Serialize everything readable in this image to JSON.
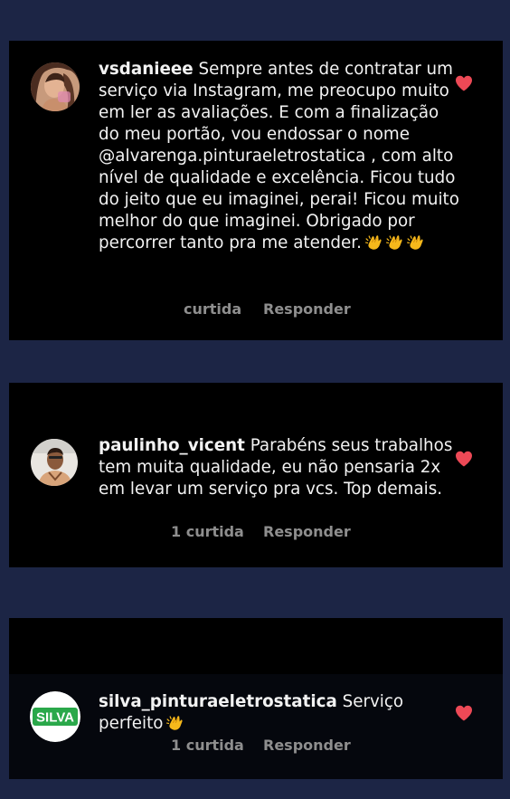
{
  "comments": [
    {
      "username": "vsdanieee",
      "text": "Sempre antes de contratar um serviço via Instagram, me preocupo muito em ler as avaliações.  E com a finalização do meu portão,  vou endossar o nome @alvarenga.pinturaeletrostatica , com alto nível de qualidade e excelência. Ficou tudo do jeito que eu imaginei, perai! Ficou muito melhor do que imaginei.  Obrigado por percorrer tanto pra me atender.",
      "emoji": "clapping-hands-icon x3",
      "likes": "curtida",
      "reply": "Responder",
      "liked": true,
      "avatar": "profile-photo"
    },
    {
      "username": "paulinho_vicent",
      "text": "Parabéns seus trabalhos tem muita qualidade, eu não pensaria 2x em levar um serviço pra vcs. Top demais.",
      "likes": "1 curtida",
      "reply": "Responder",
      "liked": true,
      "avatar": "profile-photo"
    },
    {
      "username": "silva_pinturaeletrostatica",
      "text": "Serviço perfeito",
      "emoji": "clapping-hands-icon",
      "likes": "1 curtida",
      "reply": "Responder",
      "liked": true,
      "avatar_logo_text": "SILVA"
    }
  ],
  "colors": {
    "background": "#1c2545",
    "card": "#000000",
    "text": "#f2f2f2",
    "meta": "#8e8e8e",
    "heart": "#ed4956",
    "logo_green": "#2aa84a"
  }
}
